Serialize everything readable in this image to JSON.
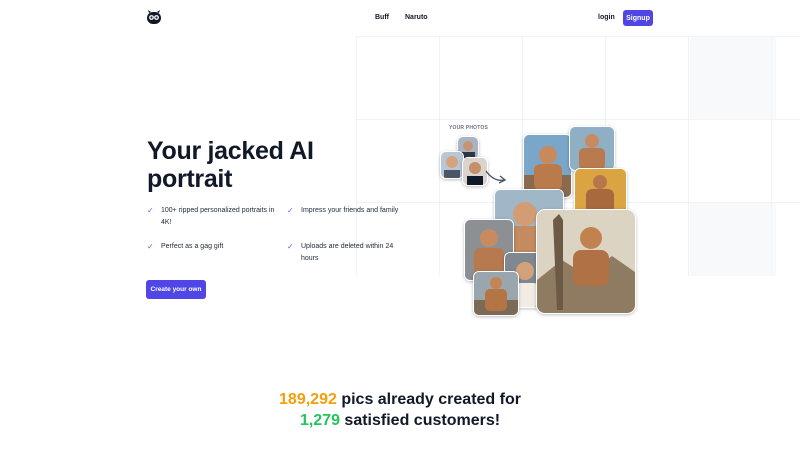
{
  "nav": {
    "links": [
      "Buff",
      "Naruto"
    ],
    "login_label": "login",
    "signup_label": "Signup",
    "logo_icon": "owl-logo-icon"
  },
  "hero": {
    "title": "Your jacked AI portrait",
    "features": [
      "100+ ripped personalized portraits in 4K!",
      "Impress your friends and family",
      "Perfect as a gag gift",
      "Uploads are deleted within 24 hours"
    ],
    "cta_label": "Create your own",
    "photos_label": "YOUR PHOTOS"
  },
  "stats": {
    "pics_count": "189,292",
    "pics_text": " pics already created for",
    "customers_count": "1,279",
    "customers_text": " satisfied customers!"
  },
  "colors": {
    "accent": "#4f46e5",
    "pics_count": "#f59e0b",
    "customers_count": "#22c55e"
  }
}
